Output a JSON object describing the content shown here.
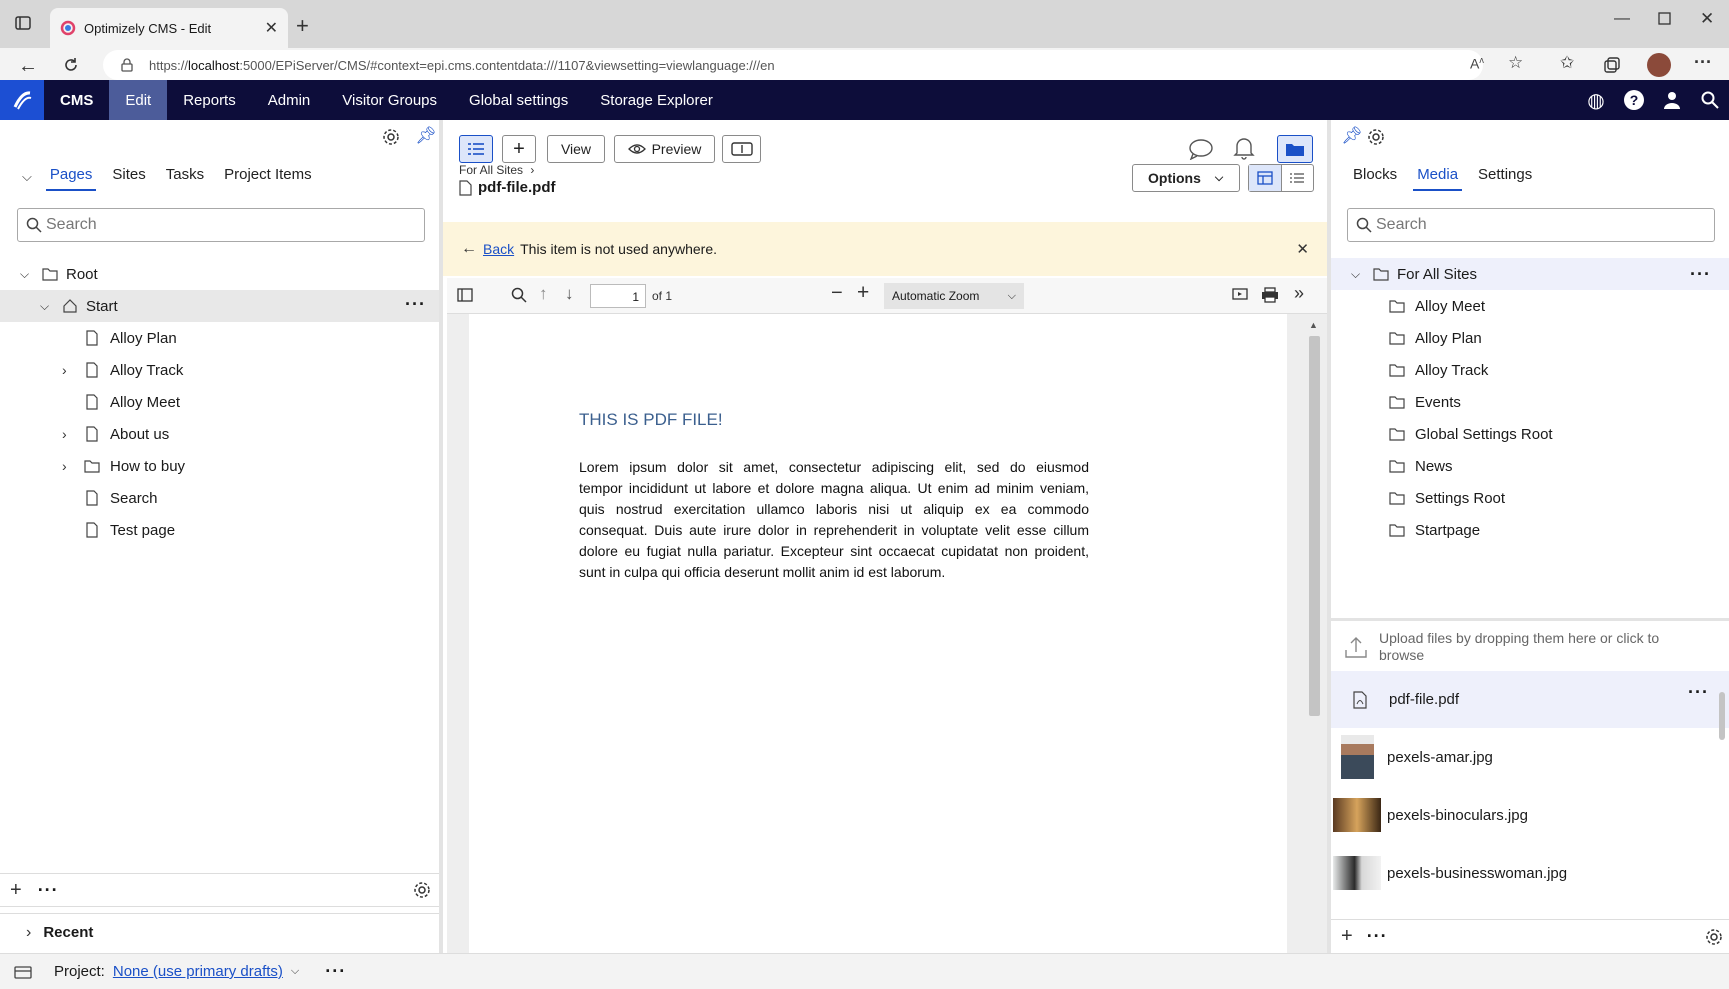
{
  "browser": {
    "tab_title": "Optimizely CMS - Edit",
    "url_prefix": "https://",
    "url_host": "localhost",
    "url_rest": ":5000/EPiServer/CMS/#context=epi.cms.contentdata:///1107&viewsetting=viewlanguage:///en"
  },
  "nav": {
    "items": [
      "CMS",
      "Edit",
      "Reports",
      "Admin",
      "Visitor Groups",
      "Global settings",
      "Storage Explorer"
    ],
    "active": "Edit"
  },
  "left": {
    "tabs": [
      "Pages",
      "Sites",
      "Tasks",
      "Project Items"
    ],
    "search_placeholder": "Search",
    "tree": {
      "root": "Root",
      "start": "Start",
      "children": [
        "Alloy Plan",
        "Alloy Track",
        "Alloy Meet",
        "About us",
        "How to buy",
        "Search",
        "Test page"
      ]
    },
    "recent_label": "Recent"
  },
  "center": {
    "buttons": {
      "view": "View",
      "preview": "Preview",
      "options": "Options"
    },
    "breadcrumb": "For All Sites",
    "file_title": "pdf-file.pdf",
    "notice": {
      "back": "Back",
      "text": "This item is not used anywhere."
    },
    "pdf": {
      "page_number": "1",
      "page_of": "of 1",
      "zoom": "Automatic Zoom",
      "heading": "THIS IS PDF FILE!",
      "paragraph_lines": [
        "Lorem ipsum dolor sit amet, consectetur adipiscing elit, sed do eiusmod",
        "tempor incididunt ut labore et dolore magna aliqua. Ut enim ad minim veniam,",
        "quis nostrud exercitation ullamco laboris nisi ut aliquip ex ea commodo",
        "consequat. Duis aute irure dolor in reprehenderit in voluptate velit esse cillum",
        "dolore eu fugiat nulla pariatur. Excepteur sint occaecat cupidatat non proident,",
        "sunt in culpa qui officia deserunt mollit anim id est laborum."
      ]
    }
  },
  "right": {
    "tabs": [
      "Blocks",
      "Media",
      "Settings"
    ],
    "search_placeholder": "Search",
    "folder_root": "For All Sites",
    "folders": [
      "Alloy Meet",
      "Alloy Plan",
      "Alloy Track",
      "Events",
      "Global Settings Root",
      "News",
      "Settings Root",
      "Startpage"
    ],
    "upload_text_1": "Upload files by dropping them here or click to",
    "upload_text_2": "browse",
    "files": [
      "pdf-file.pdf",
      "pexels-amar.jpg",
      "pexels-binoculars.jpg",
      "pexels-businesswoman.jpg"
    ]
  },
  "bottom": {
    "project_label": "Project:",
    "project_value": "None (use primary drafts)"
  },
  "colors": {
    "nav_bg": "#0d0d3a",
    "nav_active": "#4c5c9a",
    "link": "#1a50c7",
    "notice_bg": "#fdf5dc",
    "selected_row": "#eef0fb"
  }
}
